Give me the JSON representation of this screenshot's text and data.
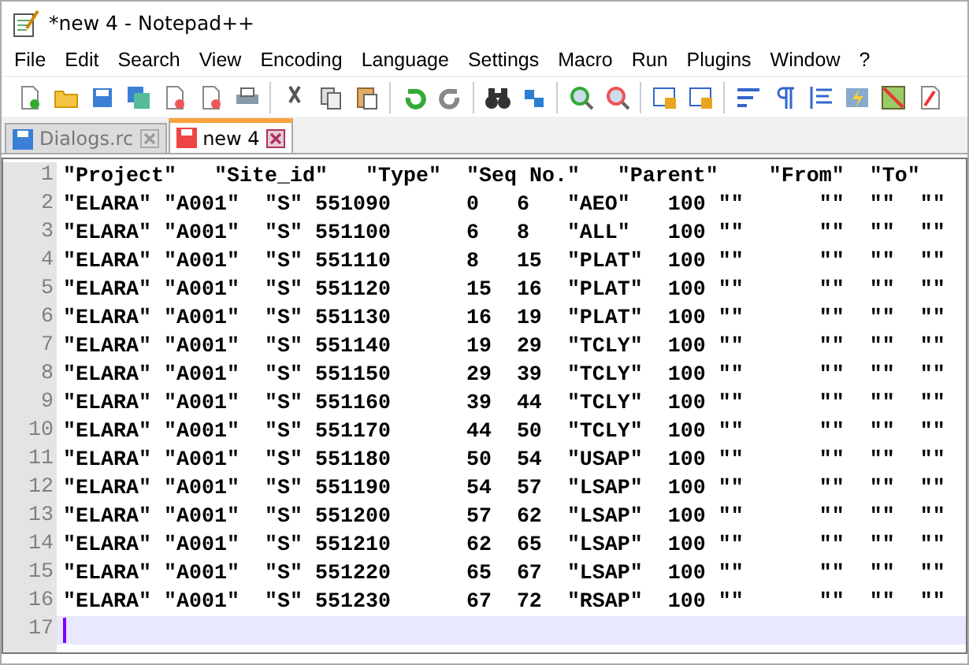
{
  "window": {
    "title": "*new 4 - Notepad++"
  },
  "menu": [
    "File",
    "Edit",
    "Search",
    "View",
    "Encoding",
    "Language",
    "Settings",
    "Macro",
    "Run",
    "Plugins",
    "Window",
    "?"
  ],
  "tabs": [
    {
      "label": "Dialogs.rc",
      "selected": false
    },
    {
      "label": "new 4",
      "selected": true
    }
  ],
  "editor": {
    "lines": [
      {
        "number": "1",
        "text": "\"Project\"\t\"Site_id\"\t\"Type\"\t\"Seq No.\"\t\"Parent\"\t\"From\"\t\"To\"",
        "current": false
      },
      {
        "number": "2",
        "text": "\"ELARA\"\t\"A001\"\t\"S\" 551090\t\t0\t6\t\"AEO\"\t100 \"\"\t\t\"\"\t\"\"\t\"\"",
        "current": false
      },
      {
        "number": "3",
        "text": "\"ELARA\"\t\"A001\"\t\"S\" 551100\t\t6\t8\t\"ALL\"\t100 \"\"\t\t\"\"\t\"\"\t\"\"",
        "current": false
      },
      {
        "number": "4",
        "text": "\"ELARA\"\t\"A001\"\t\"S\" 551110\t\t8\t15\t\"PLAT\"\t100 \"\"\t\t\"\"\t\"\"\t\"\"",
        "current": false
      },
      {
        "number": "5",
        "text": "\"ELARA\"\t\"A001\"\t\"S\" 551120\t\t15\t16\t\"PLAT\"\t100 \"\"\t\t\"\"\t\"\"\t\"\"",
        "current": false
      },
      {
        "number": "6",
        "text": "\"ELARA\"\t\"A001\"\t\"S\" 551130\t\t16\t19\t\"PLAT\"\t100 \"\"\t\t\"\"\t\"\"\t\"\"",
        "current": false
      },
      {
        "number": "7",
        "text": "\"ELARA\"\t\"A001\"\t\"S\" 551140\t\t19\t29\t\"TCLY\"\t100 \"\"\t\t\"\"\t\"\"\t\"\"",
        "current": false
      },
      {
        "number": "8",
        "text": "\"ELARA\"\t\"A001\"\t\"S\" 551150\t\t29\t39\t\"TCLY\"\t100 \"\"\t\t\"\"\t\"\"\t\"\"",
        "current": false
      },
      {
        "number": "9",
        "text": "\"ELARA\"\t\"A001\"\t\"S\" 551160\t\t39\t44\t\"TCLY\"\t100 \"\"\t\t\"\"\t\"\"\t\"\"",
        "current": false
      },
      {
        "number": "10",
        "text": "\"ELARA\"\t\"A001\"\t\"S\" 551170\t\t44\t50\t\"TCLY\"\t100 \"\"\t\t\"\"\t\"\"\t\"\"",
        "current": false
      },
      {
        "number": "11",
        "text": "\"ELARA\"\t\"A001\"\t\"S\" 551180\t\t50\t54\t\"USAP\"\t100 \"\"\t\t\"\"\t\"\"\t\"\"",
        "current": false
      },
      {
        "number": "12",
        "text": "\"ELARA\"\t\"A001\"\t\"S\" 551190\t\t54\t57\t\"LSAP\"\t100 \"\"\t\t\"\"\t\"\"\t\"\"",
        "current": false
      },
      {
        "number": "13",
        "text": "\"ELARA\"\t\"A001\"\t\"S\" 551200\t\t57\t62\t\"LSAP\"\t100 \"\"\t\t\"\"\t\"\"\t\"\"",
        "current": false
      },
      {
        "number": "14",
        "text": "\"ELARA\"\t\"A001\"\t\"S\" 551210\t\t62\t65\t\"LSAP\"\t100 \"\"\t\t\"\"\t\"\"\t\"\"",
        "current": false
      },
      {
        "number": "15",
        "text": "\"ELARA\"\t\"A001\"\t\"S\" 551220\t\t65\t67\t\"LSAP\"\t100 \"\"\t\t\"\"\t\"\"\t\"\"",
        "current": false
      },
      {
        "number": "16",
        "text": "\"ELARA\"\t\"A001\"\t\"S\" 551230\t\t67\t72\t\"RSAP\"\t100 \"\"\t\t\"\"\t\"\"\t\"\"",
        "current": false
      },
      {
        "number": "17",
        "current": true
      }
    ]
  }
}
